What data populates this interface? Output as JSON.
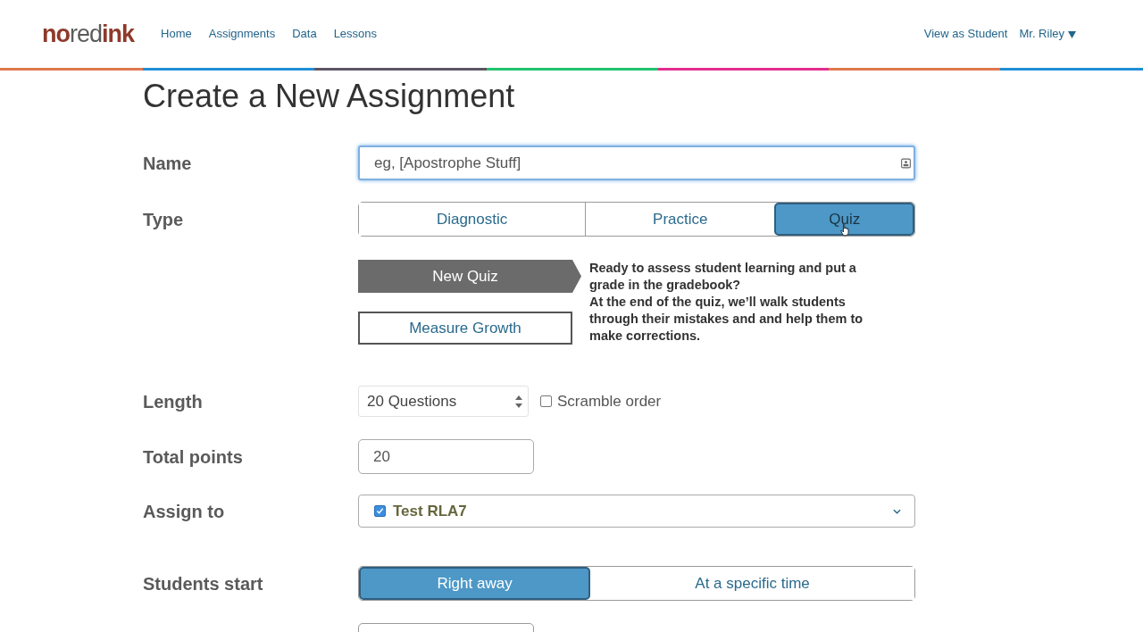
{
  "header": {
    "logo": [
      {
        "text": "no",
        "kind": "accent"
      },
      {
        "text": "red",
        "kind": "plain"
      },
      {
        "text": "ink",
        "kind": "accent"
      }
    ],
    "nav": [
      {
        "label": "Home"
      },
      {
        "label": "Assignments"
      },
      {
        "label": "Data"
      },
      {
        "label": "Lessons"
      }
    ],
    "view_as_student": "View as Student",
    "user_menu": "Mr. Riley"
  },
  "page": {
    "title": "Create a New Assignment"
  },
  "form": {
    "name": {
      "label": "Name",
      "placeholder": "eg, [Apostrophe Stuff]",
      "focused": true
    },
    "type": {
      "label": "Type",
      "options": [
        {
          "label": "Diagnostic",
          "selected": false,
          "hovered": false
        },
        {
          "label": "Practice",
          "selected": false,
          "hovered": false
        },
        {
          "label": "Quiz",
          "selected": true,
          "hovered": true
        }
      ]
    },
    "quiz_kinds": [
      {
        "label": "New Quiz",
        "selected": true
      },
      {
        "label": "Measure Growth",
        "selected": false
      }
    ],
    "description": [
      "Ready to assess student learning and put a grade in the gradebook?",
      "At the end of the quiz, we’ll walk students through their mistakes and and help them to make corrections."
    ],
    "length": {
      "label": "Length",
      "value": "20 Questions",
      "scramble": {
        "label": "Scramble order",
        "checked": false
      }
    },
    "total_points": {
      "label": "Total points",
      "value": "20"
    },
    "assign_to": {
      "label": "Assign to",
      "items": [
        {
          "label": "Test RLA7",
          "checked": true
        }
      ]
    },
    "students_start": {
      "label": "Students start",
      "options": [
        {
          "label": "Right away",
          "selected": true,
          "hovered": false
        },
        {
          "label": "At a specific time",
          "selected": false,
          "hovered": false
        }
      ]
    }
  }
}
